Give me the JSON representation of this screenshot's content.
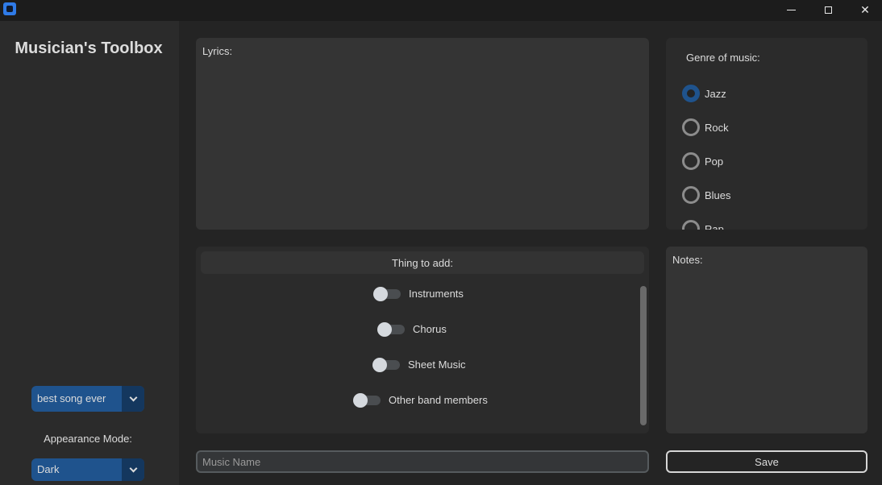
{
  "window": {
    "minimize_glyph": "",
    "close_glyph": "✕"
  },
  "sidebar": {
    "title": "Musician's Toolbox",
    "song_select": {
      "value": "best song ever"
    },
    "appearance_label": "Appearance Mode:",
    "appearance_select": {
      "value": "Dark"
    }
  },
  "lyrics": {
    "label": "Lyrics:"
  },
  "genre": {
    "label": "Genre of music:",
    "options": [
      "Jazz",
      "Rock",
      "Pop",
      "Blues",
      "Rap"
    ],
    "selected": "Jazz"
  },
  "things_to_add": {
    "header": "Thing to add:",
    "switches": [
      "Instruments",
      "Chorus",
      "Sheet Music",
      "Other band members"
    ]
  },
  "notes": {
    "label": "Notes:"
  },
  "music_name": {
    "placeholder": "Music Name",
    "value": ""
  },
  "save_button": {
    "label": "Save"
  },
  "colors": {
    "accent": "#1f538d",
    "window_bg": "#242424",
    "sidebar_bg": "#2b2b2b",
    "textbox_bg": "#343434"
  }
}
